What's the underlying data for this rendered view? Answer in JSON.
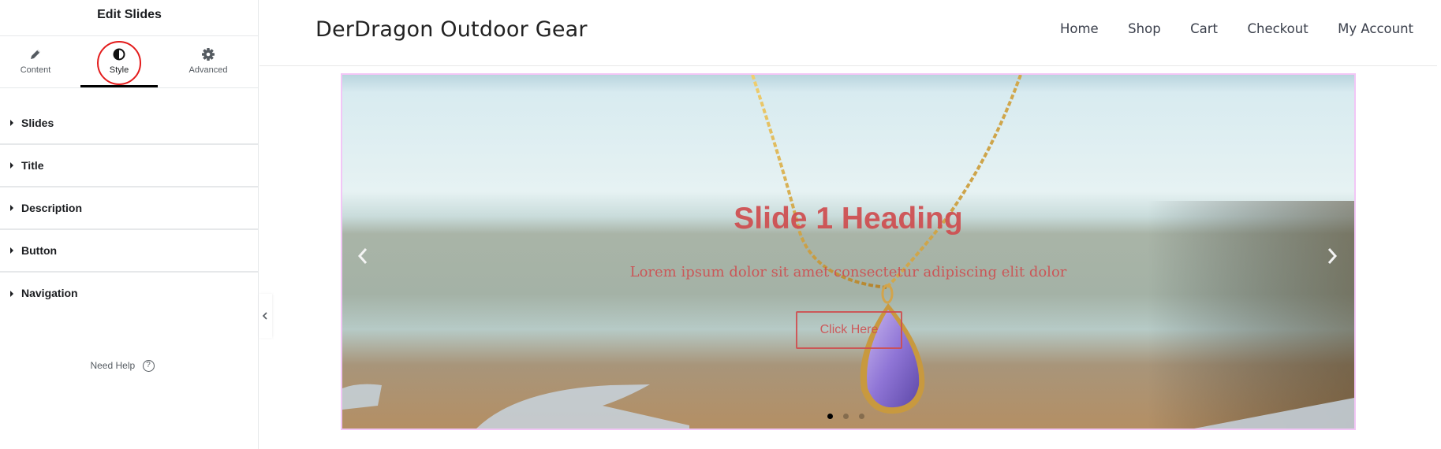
{
  "panel": {
    "title": "Edit Slides",
    "tabs": [
      {
        "label": "Content",
        "icon": "pencil-icon",
        "active": false
      },
      {
        "label": "Style",
        "icon": "contrast-icon",
        "active": true
      },
      {
        "label": "Advanced",
        "icon": "gear-icon",
        "active": false
      }
    ],
    "sections": [
      {
        "label": "Slides"
      },
      {
        "label": "Title"
      },
      {
        "label": "Description"
      },
      {
        "label": "Button"
      },
      {
        "label": "Navigation"
      }
    ],
    "help_label": "Need Help",
    "help_icon": "?",
    "highlight_color": "#e31b1b"
  },
  "site": {
    "title": "DerDragon Outdoor Gear",
    "nav": [
      "Home",
      "Shop",
      "Cart",
      "Checkout",
      "My Account"
    ]
  },
  "slider": {
    "heading": "Slide 1 Heading",
    "description": "Lorem ipsum dolor sit amet consectetur adipiscing elit dolor",
    "button_label": "Click Here",
    "text_color": "#cf4d4f",
    "border_color": "#f2c6f6",
    "slide_count": 3,
    "active_slide": 1,
    "prev_icon": "chevron-left-icon",
    "next_icon": "chevron-right-icon"
  }
}
